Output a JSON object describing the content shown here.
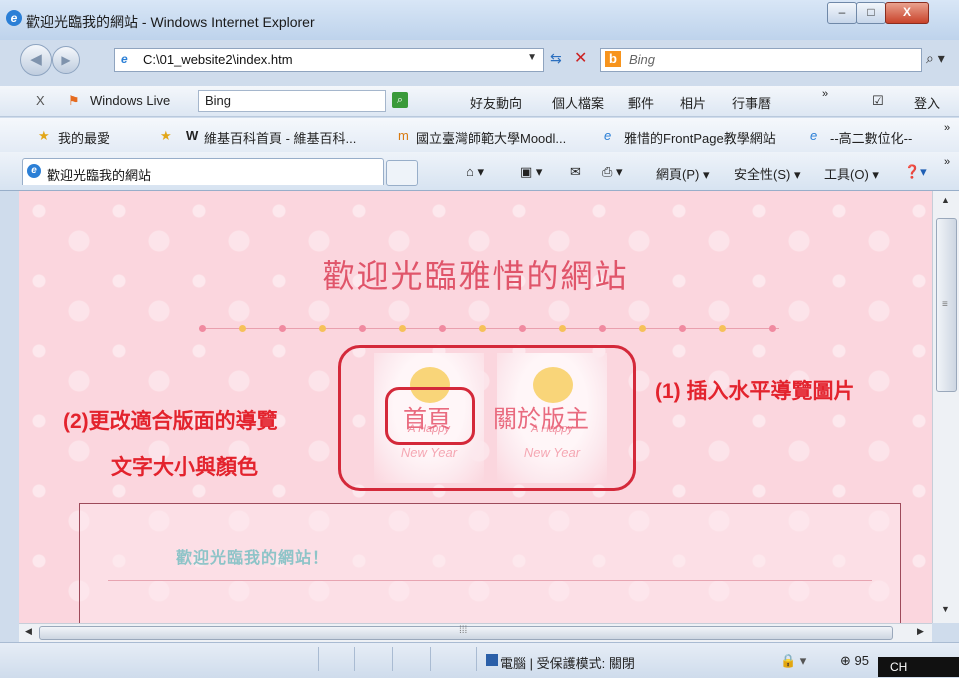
{
  "window": {
    "title": "歡迎光臨我的網站 - Windows Internet Explorer",
    "min_label": "–",
    "max_label": "□",
    "close_label": "X"
  },
  "address": {
    "url": "C:\\01_website2\\index.htm",
    "search_placeholder": "Bing"
  },
  "toolbar": {
    "close_label": "X",
    "brand": "Windows Live",
    "search_value": "Bing",
    "items": [
      "好友動向",
      "個人檔案",
      "郵件",
      "相片",
      "行事曆"
    ],
    "overflow": "»",
    "login": "登入"
  },
  "favorites": {
    "label": "我的最愛",
    "items": [
      "維基百科首頁 - 維基百科...",
      "國立臺灣師範大學Moodl...",
      "雅惜的FrontPage教學網站",
      "--高二數位化--"
    ],
    "overflow": "»"
  },
  "tab": {
    "title": "歡迎光臨我的網站"
  },
  "commandbar": {
    "page": "網頁(P) ▾",
    "safety": "安全性(S) ▾",
    "tools": "工具(O) ▾",
    "overflow": "»"
  },
  "page": {
    "title": "歡迎光臨雅惜的網站",
    "nav_images": [
      {
        "label": "首頁",
        "happy": "A Happy",
        "newyear": "New Year"
      },
      {
        "label": "關於版主",
        "happy": "A Happy",
        "newyear": "New Year"
      }
    ],
    "welcome": "歡迎光臨我的網站！"
  },
  "annotations": {
    "right": "(1) 插入水平導覽圖片",
    "left_line1": "(2)更改適合版面的導覽",
    "left_line2": "文字大小與顏色"
  },
  "status": {
    "zone": "電腦 | 受保護模式: 關閉",
    "zoom": "95",
    "lang": "CH"
  },
  "colors": {
    "accent_red": "#d4293a",
    "title_pink": "#e0556a",
    "page_bg": "#fbd6de"
  }
}
